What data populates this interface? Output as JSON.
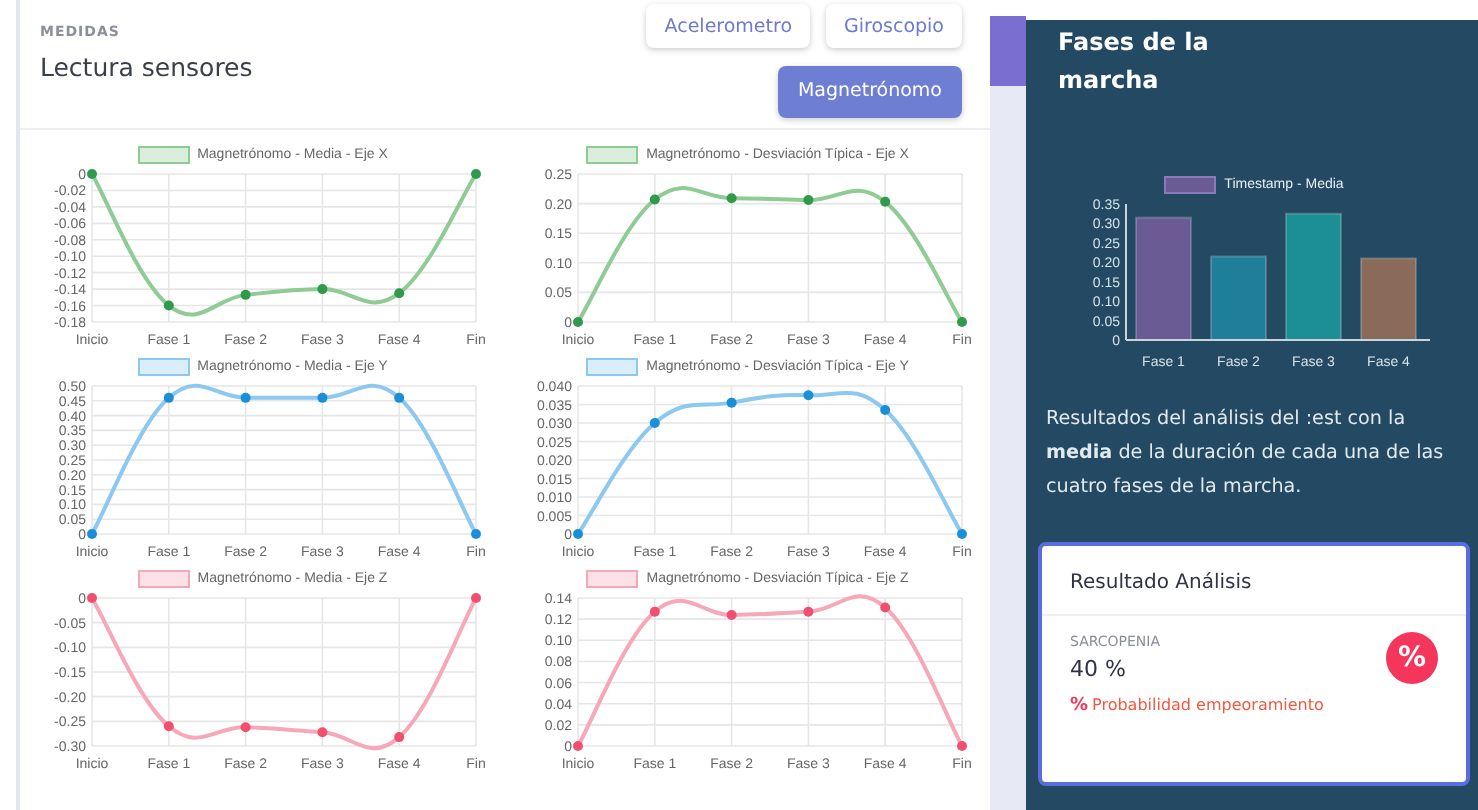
{
  "header": {
    "overline": "MEDIDAS",
    "title": "Lectura sensores"
  },
  "sensor_tabs": [
    {
      "label": "Acelerometro",
      "selected": false
    },
    {
      "label": "Giroscopio",
      "selected": false
    },
    {
      "label": "Magnetrónomo",
      "selected": true
    }
  ],
  "charts": [
    {
      "chart_data": {
        "type": "line",
        "categories": [
          "Inicio",
          "Fase 1",
          "Fase 2",
          "Fase 3",
          "Fase 4",
          "Fin"
        ],
        "ylim": [
          -0.18,
          0
        ],
        "yticks": [
          {
            "value": 0,
            "label": "0"
          },
          {
            "value": -0.02,
            "label": "-0.02"
          },
          {
            "value": -0.04,
            "label": "-0.04"
          },
          {
            "value": -0.06,
            "label": "-0.06"
          },
          {
            "value": -0.08,
            "label": "-0.08"
          },
          {
            "value": -0.1,
            "label": "-0.10"
          },
          {
            "value": -0.12,
            "label": "-0.12"
          },
          {
            "value": -0.14,
            "label": "-0.14"
          },
          {
            "value": -0.16,
            "label": "-0.16"
          },
          {
            "value": -0.18,
            "label": "-0.18"
          }
        ],
        "grid": true,
        "series": [
          {
            "name": "Magnetrónomo - Media - Eje X",
            "color": "#8fcb94",
            "marker": true,
            "values": [
              0,
              -0.16,
              -0.147,
              -0.14,
              -0.145,
              0
            ]
          }
        ]
      }
    },
    {
      "chart_data": {
        "type": "line",
        "categories": [
          "Inicio",
          "Fase 1",
          "Fase 2",
          "Fase 3",
          "Fase 4",
          "Fin"
        ],
        "ylim": [
          0,
          0.25
        ],
        "yticks": [
          {
            "value": 0,
            "label": "0"
          },
          {
            "value": 0.05,
            "label": "0.05"
          },
          {
            "value": 0.1,
            "label": "0.10"
          },
          {
            "value": 0.15,
            "label": "0.15"
          },
          {
            "value": 0.2,
            "label": "0.20"
          },
          {
            "value": 0.25,
            "label": "0.25"
          }
        ],
        "grid": true,
        "series": [
          {
            "name": "Magnetrónomo - Desviación Típica - Eje X",
            "color": "#8fcb94",
            "marker": true,
            "values": [
              0,
              0.207,
              0.209,
              0.206,
              0.203,
              0
            ]
          }
        ]
      }
    },
    {
      "chart_data": {
        "type": "line",
        "categories": [
          "Inicio",
          "Fase 1",
          "Fase 2",
          "Fase 3",
          "Fase 4",
          "Fin"
        ],
        "ylim": [
          0,
          0.5
        ],
        "yticks": [
          {
            "value": 0,
            "label": "0"
          },
          {
            "value": 0.05,
            "label": "0.05"
          },
          {
            "value": 0.1,
            "label": "0.10"
          },
          {
            "value": 0.15,
            "label": "0.15"
          },
          {
            "value": 0.2,
            "label": "0.20"
          },
          {
            "value": 0.25,
            "label": "0.25"
          },
          {
            "value": 0.3,
            "label": "0.30"
          },
          {
            "value": 0.35,
            "label": "0.35"
          },
          {
            "value": 0.4,
            "label": "0.40"
          },
          {
            "value": 0.45,
            "label": "0.45"
          },
          {
            "value": 0.5,
            "label": "0.50"
          }
        ],
        "grid": true,
        "series": [
          {
            "name": "Magnetrónomo - Media - Eje Y",
            "color": "#8cc8ef",
            "marker": true,
            "values": [
              0,
              0.46,
              0.46,
              0.46,
              0.46,
              0
            ]
          }
        ]
      }
    },
    {
      "chart_data": {
        "type": "line",
        "categories": [
          "Inicio",
          "Fase 1",
          "Fase 2",
          "Fase 3",
          "Fase 4",
          "Fin"
        ],
        "ylim": [
          0,
          0.04
        ],
        "yticks": [
          {
            "value": 0,
            "label": "0"
          },
          {
            "value": 0.005,
            "label": "0.005"
          },
          {
            "value": 0.01,
            "label": "0.010"
          },
          {
            "value": 0.015,
            "label": "0.015"
          },
          {
            "value": 0.02,
            "label": "0.020"
          },
          {
            "value": 0.025,
            "label": "0.025"
          },
          {
            "value": 0.03,
            "label": "0.030"
          },
          {
            "value": 0.035,
            "label": "0.035"
          },
          {
            "value": 0.04,
            "label": "0.040"
          }
        ],
        "grid": true,
        "series": [
          {
            "name": "Magnetrónomo - Desviación Típica - Eje Y",
            "color": "#8cc8ef",
            "marker": true,
            "values": [
              0,
              0.03,
              0.0355,
              0.0375,
              0.0335,
              0
            ]
          }
        ]
      }
    },
    {
      "chart_data": {
        "type": "line",
        "categories": [
          "Inicio",
          "Fase 1",
          "Fase 2",
          "Fase 3",
          "Fase 4",
          "Fin"
        ],
        "ylim": [
          -0.3,
          0
        ],
        "yticks": [
          {
            "value": 0,
            "label": "0"
          },
          {
            "value": -0.05,
            "label": "-0.05"
          },
          {
            "value": -0.1,
            "label": "-0.10"
          },
          {
            "value": -0.15,
            "label": "-0.15"
          },
          {
            "value": -0.2,
            "label": "-0.20"
          },
          {
            "value": -0.25,
            "label": "-0.25"
          },
          {
            "value": -0.3,
            "label": "-0.30"
          }
        ],
        "grid": true,
        "series": [
          {
            "name": "Magnetrónomo - Media - Eje Z",
            "color": "#f7a8b8",
            "marker": true,
            "values": [
              0,
              -0.26,
              -0.262,
              -0.272,
              -0.282,
              0
            ]
          }
        ]
      }
    },
    {
      "chart_data": {
        "type": "line",
        "categories": [
          "Inicio",
          "Fase 1",
          "Fase 2",
          "Fase 3",
          "Fase 4",
          "Fin"
        ],
        "ylim": [
          0,
          0.14
        ],
        "yticks": [
          {
            "value": 0,
            "label": "0"
          },
          {
            "value": 0.02,
            "label": "0.02"
          },
          {
            "value": 0.04,
            "label": "0.04"
          },
          {
            "value": 0.06,
            "label": "0.06"
          },
          {
            "value": 0.08,
            "label": "0.08"
          },
          {
            "value": 0.1,
            "label": "0.10"
          },
          {
            "value": 0.12,
            "label": "0.12"
          },
          {
            "value": 0.14,
            "label": "0.14"
          }
        ],
        "grid": true,
        "series": [
          {
            "name": "Magnetrónomo - Desviación Típica - Eje Z",
            "color": "#f7a8b8",
            "marker": true,
            "values": [
              0,
              0.127,
              0.124,
              0.127,
              0.131,
              0
            ]
          }
        ]
      }
    }
  ],
  "phases": {
    "title": "Fases de la marcha",
    "chart_data": {
      "type": "bar",
      "categories": [
        "Fase 1",
        "Fase 2",
        "Fase 3",
        "Fase 4"
      ],
      "ylim": [
        0,
        0.35
      ],
      "yticks": [
        {
          "value": 0,
          "label": "0"
        },
        {
          "value": 0.05,
          "label": "0.05"
        },
        {
          "value": 0.1,
          "label": "0.10"
        },
        {
          "value": 0.15,
          "label": "0.15"
        },
        {
          "value": 0.2,
          "label": "0.20"
        },
        {
          "value": 0.25,
          "label": "0.25"
        },
        {
          "value": 0.3,
          "label": "0.30"
        },
        {
          "value": 0.35,
          "label": "0.35"
        }
      ],
      "series": [
        {
          "name": "Timestamp - Media",
          "values": [
            0.315,
            0.215,
            0.325,
            0.21
          ]
        }
      ]
    },
    "bars": [
      {
        "color": "#6b5b95"
      },
      {
        "color": "#1f7f9a"
      },
      {
        "color": "#1b8f94"
      },
      {
        "color": "#8a6a58"
      }
    ],
    "description": "Resultados del análisis del :est con la **media** de la duración de cada una de las cuatro fases de la marcha."
  },
  "result": {
    "title": "Resultado Análisis",
    "label": "SARCOPENIA",
    "value": "40 %",
    "badge_symbol": "%",
    "trend_symbol": "%",
    "trend_text": "Probabilidad empeoramiento"
  }
}
